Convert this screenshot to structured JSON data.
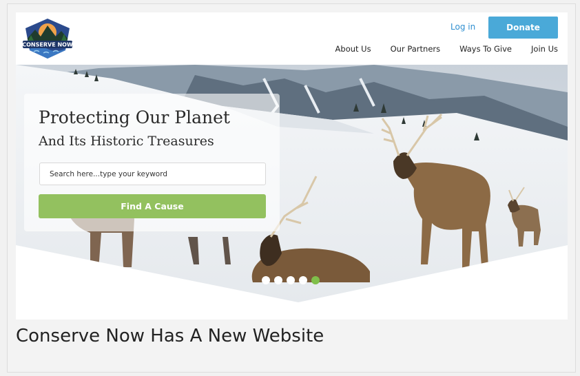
{
  "header": {
    "logo_text": "CONSERVE NOW",
    "login_label": "Log in",
    "donate_label": "Donate",
    "nav": [
      {
        "label": "About Us"
      },
      {
        "label": "Our Partners"
      },
      {
        "label": "Ways To Give"
      },
      {
        "label": "Join Us"
      }
    ]
  },
  "hero": {
    "title": "Protecting Our Planet",
    "subtitle": "And Its Historic Treasures",
    "search": {
      "placeholder": "Search here...type your keyword",
      "value": ""
    },
    "find_label": "Find A Cause",
    "slides": {
      "count": 5,
      "active_index": 4
    },
    "colors": {
      "accent_green": "#93c15f",
      "donate_blue": "#4aa9d8"
    }
  },
  "caption": "Conserve Now Has A New Website"
}
